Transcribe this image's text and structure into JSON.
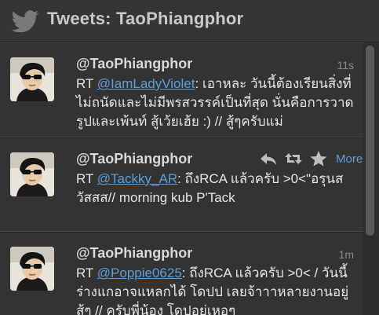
{
  "header": {
    "title": "Tweets: TaoPhiangphor",
    "icon": "twitter-bird-icon"
  },
  "tweets": [
    {
      "name": "@TaoPhiangphor",
      "time": "11s",
      "prefix": "RT ",
      "mention": "@IamLadyViolet",
      "body": ": เอาหละ วันนี้ต้องเรียนสิ่งที่ไม่ถนัดและไม่มีพรสวรรค์เป็นที่สุด นั่นคือการวาดรูปและเพ้นท์ สู้เว้ยเฮ้ย :) // สู้ๆครับแม่"
    },
    {
      "name": "@TaoPhiangphor",
      "time": "",
      "prefix": "RT ",
      "mention": "@Tackky_AR",
      "body": ": ถึงRCA แล้วครับ >0<\"อรุนสวัสสส// morning kub P'Tack",
      "actions": {
        "more_label": "More"
      }
    },
    {
      "name": "@TaoPhiangphor",
      "time": "1m",
      "prefix": "RT ",
      "mention": "@Poppie0625",
      "body": ": ถึงRCA แล้วครับ >0< / วันนี้ร่างแกอาจแหลกได้ โดปป เลยจ้าาาหลายงานอยู่ สู้ๆ // ครับพี่น้อง โดปอยู่เหอๆ"
    }
  ],
  "colors": {
    "background": "#333333",
    "link": "#5b9fd8",
    "name": "#d8d8d8",
    "text": "#e6e6e6",
    "time": "#8a8a8a"
  }
}
